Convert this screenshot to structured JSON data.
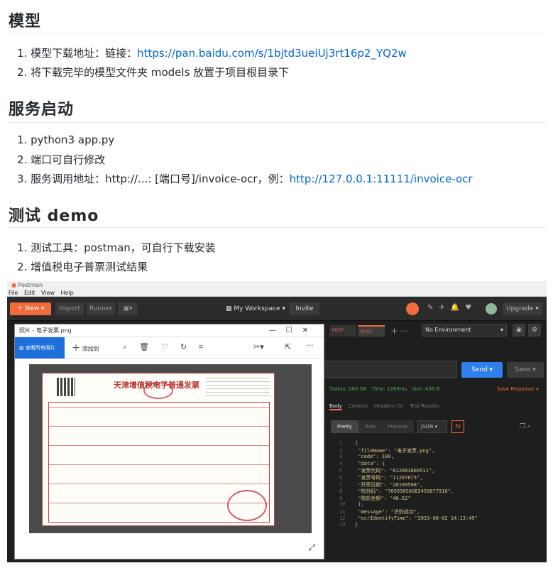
{
  "sections": {
    "model": {
      "heading": "模型",
      "items": [
        {
          "num": "1.",
          "text": "模型下载地址：链接：",
          "link": "https://pan.baidu.com/s/1bjtd3ueiUj3rt16p2_YQ2w"
        },
        {
          "num": "2.",
          "text": "将下载完毕的模型文件夹 models 放置于项目根目录下"
        }
      ]
    },
    "service": {
      "heading": "服务启动",
      "items": [
        {
          "num": "1.",
          "text": "python3 app.py"
        },
        {
          "num": "2.",
          "text": "端口可自行修改"
        },
        {
          "num": "3.",
          "text": "服务调用地址：http://...: [端口号]/invoice-ocr，例：",
          "link": "http://127.0.0.1:11111/invoice-ocr"
        }
      ]
    },
    "demo": {
      "heading": "测试 demo",
      "items": [
        {
          "num": "1.",
          "text": "测试工具：postman，可自行下载安装"
        },
        {
          "num": "2.",
          "text": "增值税电子普票测试结果"
        }
      ]
    }
  },
  "postman": {
    "window_title": "Postman",
    "menu": [
      "File",
      "Edit",
      "View",
      "Help"
    ],
    "new_label": "New",
    "import_label": "Import",
    "runner_label": "Runner",
    "workspace_label": "My Workspace",
    "invite_label": "Invite",
    "upgrade_label": "Upgrade",
    "tab1": "POST",
    "tab2": "POST",
    "env_label": "No Environment",
    "send_label": "Send",
    "save_label": "Save",
    "status": "Status: 200 OK",
    "time": "Time: 1269ms",
    "size": "Size: 436 B",
    "save_response": "Save Response",
    "resp_tabs": [
      "Body",
      "Cookies",
      "Headers (3)",
      "Test Results"
    ],
    "view_modes": [
      "Pretty",
      "Raw",
      "Preview"
    ],
    "format": "JSON",
    "code_lines": [
      "{",
      "    \"fileName\": \"电子发票.png\",",
      "    \"code\": 100,",
      "    \"data\": {",
      "        \"发票代码\": \"012001800511\",",
      "        \"发票号码\": \"11207675\",",
      "        \"开票日期\": \"20190508\",",
      "        \"校验码\": \"76939056083456677910\",",
      "        \"税前金额\": \"46.62\"",
      "    },",
      "    \"message\": \"识别成功\",",
      "    \"ocrIdentifyTime\": \"2019-08-02 14:13:49\"",
      "}"
    ]
  },
  "viewer": {
    "title": "照片 - 电子发票.png",
    "view_all": "查看所有照片",
    "add_to": "添加到",
    "invoice_title": "天津增值税电子普通发票"
  }
}
